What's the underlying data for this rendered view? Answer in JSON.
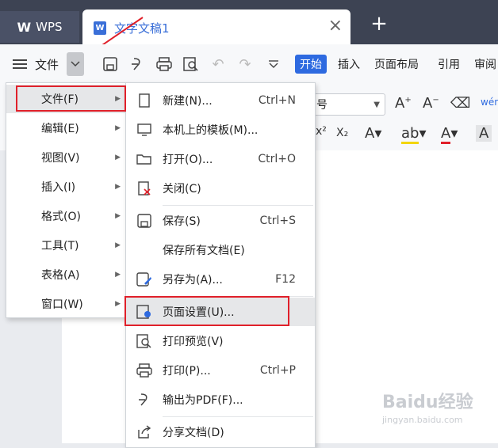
{
  "titlebar": {
    "wps_label": "WPS",
    "doc_tab_title": "文字文稿1",
    "close_glyph": "×",
    "new_tab_glyph": "+"
  },
  "toolbar": {
    "file_label": "文件",
    "tabs": [
      "开始",
      "插入",
      "页面布局",
      "引用",
      "审阅"
    ]
  },
  "fontrow": {
    "font_size_value": "号"
  },
  "main_menu": {
    "items": [
      {
        "label": "文件(F)"
      },
      {
        "label": "编辑(E)"
      },
      {
        "label": "视图(V)"
      },
      {
        "label": "插入(I)"
      },
      {
        "label": "格式(O)"
      },
      {
        "label": "工具(T)"
      },
      {
        "label": "表格(A)"
      },
      {
        "label": "窗口(W)"
      }
    ]
  },
  "sub_menu": {
    "items": [
      {
        "label": "新建(N)...",
        "shortcut": "Ctrl+N",
        "icon": "new-doc-icon"
      },
      {
        "label": "本机上的模板(M)...",
        "shortcut": "",
        "icon": "template-icon"
      },
      {
        "label": "打开(O)...",
        "shortcut": "Ctrl+O",
        "icon": "folder-icon"
      },
      {
        "label": "关闭(C)",
        "shortcut": "",
        "icon": "close-doc-icon"
      },
      {
        "label": "保存(S)",
        "shortcut": "Ctrl+S",
        "icon": "save-icon"
      },
      {
        "label": "保存所有文档(E)",
        "shortcut": "",
        "icon": ""
      },
      {
        "label": "另存为(A)...",
        "shortcut": "F12",
        "icon": "save-as-icon"
      },
      {
        "label": "页面设置(U)...",
        "shortcut": "",
        "icon": "page-setup-icon"
      },
      {
        "label": "打印预览(V)",
        "shortcut": "",
        "icon": "print-preview-icon"
      },
      {
        "label": "打印(P)...",
        "shortcut": "Ctrl+P",
        "icon": "printer-icon"
      },
      {
        "label": "输出为PDF(F)...",
        "shortcut": "",
        "icon": "export-pdf-icon"
      },
      {
        "label": "分享文档(D)",
        "shortcut": "",
        "icon": "share-icon"
      }
    ]
  },
  "watermark": {
    "brand": "Baidu经验",
    "url": "jingyan.baidu.com"
  },
  "colors": {
    "accent": "#2e6ae0",
    "highlight_box": "#e0202a",
    "titlebar": "#3d4353"
  }
}
